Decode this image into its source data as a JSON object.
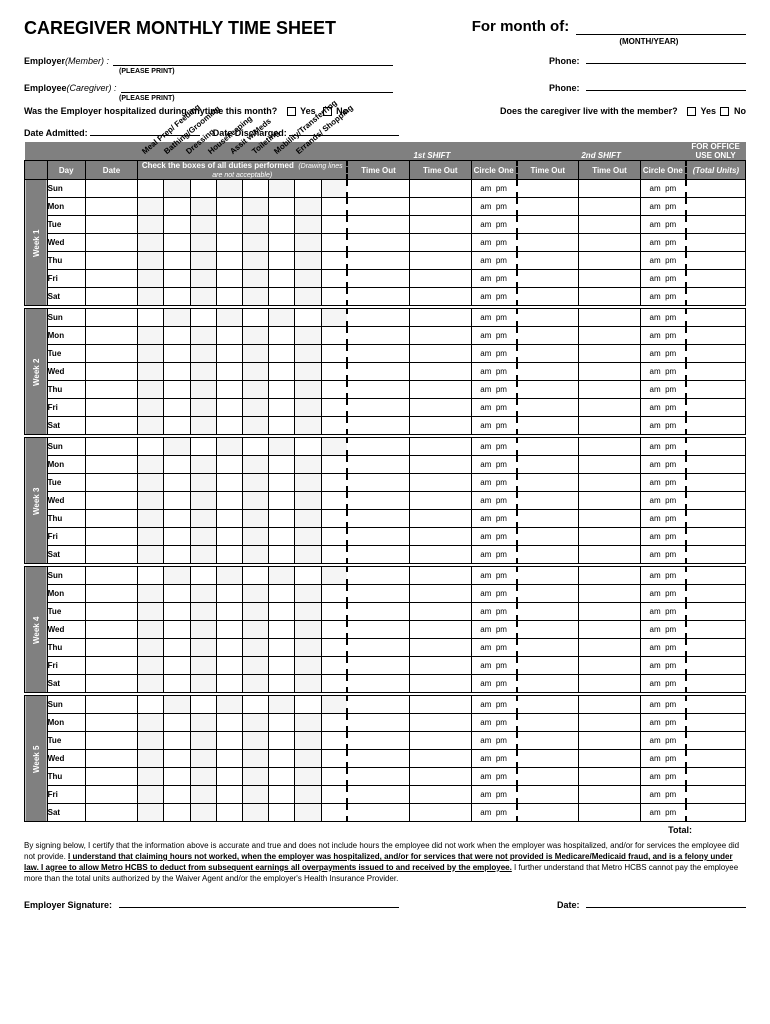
{
  "title": "CAREGIVER MONTHLY TIME SHEET",
  "month_label": "For month of:",
  "month_sub": "(MONTH/YEAR)",
  "employer_label": "Employer",
  "employer_sub": " (Member) :",
  "employee_label": "Employee",
  "employee_sub": " (Caregiver) :",
  "phone_label": "Phone:",
  "print_note": "(PLEASE PRINT)",
  "hosp_question": "Was the Employer hospitalized during anytime this month?",
  "live_question": "Does the caregiver live with the member?",
  "yes": "Yes",
  "no": "No",
  "date_admitted": "Date Admitted:",
  "date_discharged": "Date Discharged",
  "duties": [
    "Meal Prep/ Feeding",
    "Bathing/Grooming",
    "Dressing",
    "Housekeeping",
    "Assit w/Meds",
    "Toileting",
    "Mobility/Transferring",
    "Errands/ Shopping"
  ],
  "duties_head": "Check the boxes of all duties performed",
  "duties_sub": "(Drawing lines are not acceptable)",
  "shift1": "1st SHIFT",
  "shift2": "2nd SHIFT",
  "office_head": "FOR OFFICE USE ONLY",
  "col_day": "Day",
  "col_date": "Date",
  "col_timeout": "Time Out",
  "col_circle": "Circle One",
  "col_total": "(Total Units)",
  "am": "am",
  "pm": "pm",
  "weeks": [
    "Week  1",
    "Week  2",
    "Week  3",
    "Week  4",
    "Week  5"
  ],
  "days": [
    "Sun",
    "Mon",
    "Tue",
    "Wed",
    "Thu",
    "Fri",
    "Sat"
  ],
  "total_label": "Total:",
  "disclaimer_1": "By signing below, I certify that the information above is accurate and true and does not include hours the employee did not work when the employer was hospitalized, and/or for services the employee did not provide. ",
  "disclaimer_2": "I understand that claiming hours not worked, when the employer was hospitalized, and/or for services that were not provided is Medicare/Medicaid fraud, and is a felony under law. I agree to allow Metro HCBS to deduct from subsequent earnings all overpayments issued to and received by the employee.",
  "disclaimer_3": " I further understand that Metro HCBS cannot pay the employee more than the total units authorized by the Waiver Agent and/or the employer's Health Insurance Provider.",
  "sig_label": "Employer Signature:",
  "sig_date": "Date:"
}
